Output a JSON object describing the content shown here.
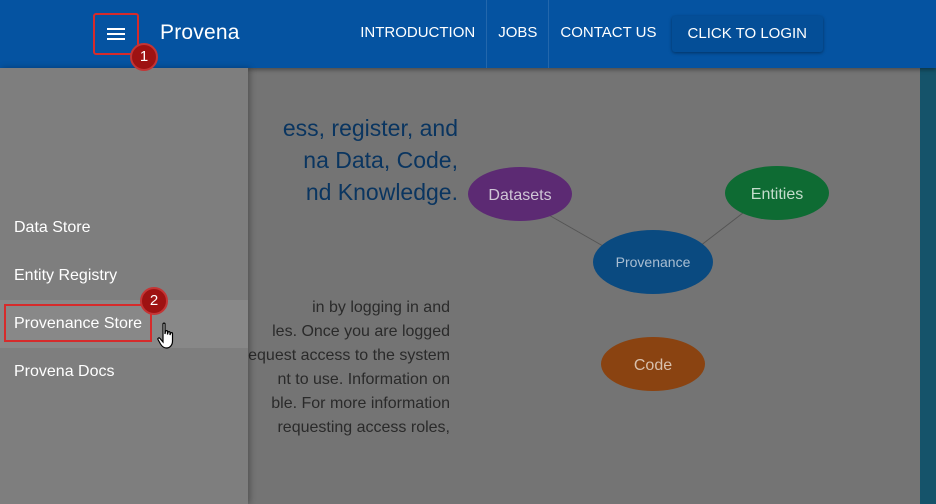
{
  "header": {
    "brand": "Provena",
    "nav": [
      "INTRODUCTION",
      "JOBS",
      "CONTACT US"
    ],
    "login_label": "CLICK TO LOGIN"
  },
  "drawer": {
    "items": [
      {
        "label": "Data Store"
      },
      {
        "label": "Entity Registry"
      },
      {
        "label": "Provenance Store",
        "active": true
      },
      {
        "label": "Provena Docs"
      }
    ]
  },
  "hero": {
    "lines": [
      "ess, register, and",
      "na Data, Code,",
      "nd Knowledge."
    ]
  },
  "body_text": {
    "lines": [
      "in by logging in and",
      "les. Once you are logged",
      "equest access to the system",
      "nt to use. Information on",
      "ble. For more information",
      "requesting access roles,"
    ]
  },
  "diagram": {
    "nodes": [
      {
        "label": "Datasets",
        "color": "#5c2a73"
      },
      {
        "label": "Entities",
        "color": "#0e6b33"
      },
      {
        "label": "Provenance",
        "color": "#0a4a80"
      },
      {
        "label": "Code",
        "color": "#8a4311"
      }
    ]
  },
  "annotations": {
    "step1": "1",
    "step2": "2"
  },
  "colors": {
    "appbar": "#0553a1",
    "highlight": "#d62b2b",
    "badge": "#9e1212"
  }
}
